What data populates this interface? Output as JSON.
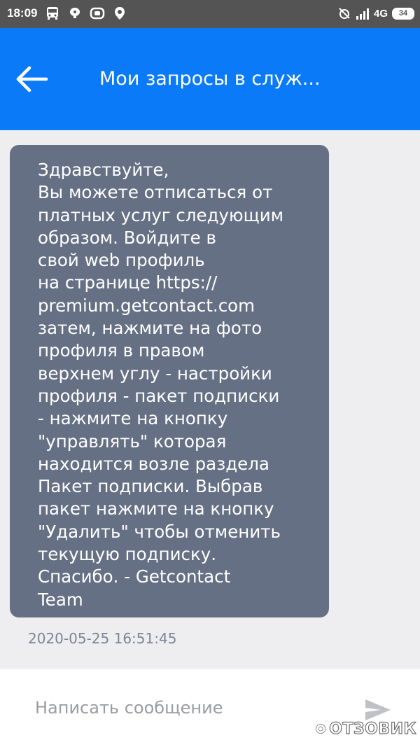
{
  "status_bar": {
    "time": "18:09",
    "network": "4G",
    "battery": "34",
    "icons": [
      "bus-icon",
      "balloon-icon",
      "cast-icon",
      "location-icon",
      "alarm-off-icon",
      "signal-icon",
      "battery-icon"
    ]
  },
  "header": {
    "back_icon": "back-arrow-icon",
    "title": "Мои запросы в служ..."
  },
  "message": {
    "lines": [
      "Здравствуйте,",
      "Вы можете отписаться от",
      "платных услуг следующим",
      "образом. Войдите в",
      "свой web профиль",
      "на странице https://",
      "premium.getcontact.com",
      "затем, нажмите на фото",
      "профиля в правом",
      "верхнем углу - настройки",
      "профиля - пакет подписки",
      "- нажмите на кнопку",
      "\"управлять\" которая",
      "находится возле раздела",
      "Пакет подписки. Выбрав",
      "пакет нажмите на кнопку",
      "\"Удалить\" чтобы отменить",
      "текущую подписку.",
      "Спасибо. - Getcontact",
      "Team"
    ],
    "timestamp": "2020-05-25 16:51:45"
  },
  "composer": {
    "value": "",
    "placeholder": "Написать сообщение",
    "send_icon": "send-icon"
  },
  "watermark": {
    "text": "ОТЗОВИК"
  },
  "colors": {
    "status_bar": "#545454",
    "app_bar": "#0a7af8",
    "bubble": "#667085",
    "background": "#eeeef0",
    "timestamp": "#7f8594",
    "placeholder": "#9a9ca3"
  }
}
